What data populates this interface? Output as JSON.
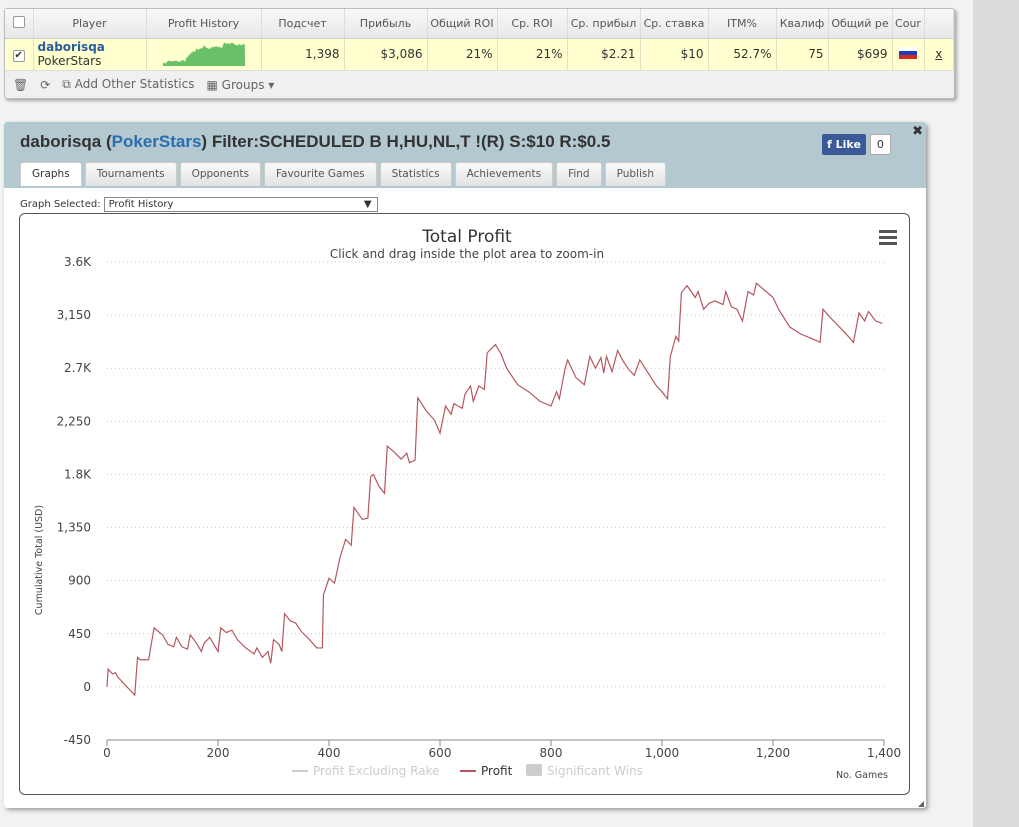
{
  "table": {
    "headers": [
      "Player",
      "Profit History",
      "Подсчет",
      "Прибыль",
      "Общий ROI",
      "Ср. ROI",
      "Ср. прибыл",
      "Ср. ставка",
      "ITM%",
      "Квалиф",
      "Общий ре",
      "Cour"
    ],
    "row": {
      "player": "daborisqa",
      "site": "PokerStars",
      "count": "1,398",
      "profit": "$3,086",
      "total_roi": "21%",
      "avg_roi": "21%",
      "avg_profit": "$2.21",
      "avg_stake": "$10",
      "itm": "52.7%",
      "qual": "75",
      "total_re": "$699",
      "country": "russia-flag",
      "remove": "x"
    },
    "tools": {
      "add_stats": "Add Other Statistics",
      "groups": "Groups"
    }
  },
  "panel": {
    "player": "daborisqa",
    "site": "PokerStars",
    "filter": "Filter:SCHEDULED B H,HU,NL,T !(R) S:$10 R:$0.5",
    "like": "Like",
    "like_count": "0",
    "tabs": [
      "Graphs",
      "Tournaments",
      "Opponents",
      "Favourite Games",
      "Statistics",
      "Achievements",
      "Find",
      "Publish"
    ],
    "graph_label": "Graph Selected:",
    "graph_value": "Profit History"
  },
  "colors": {
    "line": "#b5575e",
    "spark": "#6abf69"
  },
  "chart_data": {
    "type": "line",
    "title": "Total Profit",
    "subtitle": "Click and drag inside the plot area to zoom-in",
    "xlabel": "No. Games",
    "ylabel": "Cumulative Total (USD)",
    "xlim": [
      0,
      1400
    ],
    "ylim": [
      -450,
      3600
    ],
    "xticks": [
      "0",
      "200",
      "400",
      "600",
      "800",
      "1,000",
      "1,200",
      "1,400"
    ],
    "yticks": [
      "-450",
      "0",
      "450",
      "900",
      "1,350",
      "1.8K",
      "2,250",
      "2.7K",
      "3,150",
      "3.6K"
    ],
    "legend": [
      "Profit Excluding Rake",
      "Profit",
      "Significant Wins"
    ],
    "series": [
      {
        "name": "Profit",
        "points": [
          [
            0,
            0
          ],
          [
            2,
            150
          ],
          [
            10,
            110
          ],
          [
            15,
            120
          ],
          [
            20,
            80
          ],
          [
            30,
            30
          ],
          [
            50,
            -70
          ],
          [
            55,
            250
          ],
          [
            60,
            230
          ],
          [
            75,
            230
          ],
          [
            80,
            370
          ],
          [
            85,
            500
          ],
          [
            90,
            480
          ],
          [
            100,
            440
          ],
          [
            110,
            360
          ],
          [
            120,
            340
          ],
          [
            125,
            420
          ],
          [
            135,
            340
          ],
          [
            145,
            320
          ],
          [
            150,
            440
          ],
          [
            160,
            380
          ],
          [
            170,
            300
          ],
          [
            175,
            370
          ],
          [
            185,
            420
          ],
          [
            200,
            300
          ],
          [
            205,
            500
          ],
          [
            215,
            460
          ],
          [
            225,
            480
          ],
          [
            235,
            400
          ],
          [
            250,
            330
          ],
          [
            265,
            280
          ],
          [
            270,
            330
          ],
          [
            280,
            250
          ],
          [
            290,
            300
          ],
          [
            295,
            200
          ],
          [
            300,
            400
          ],
          [
            310,
            360
          ],
          [
            315,
            300
          ],
          [
            320,
            620
          ],
          [
            330,
            560
          ],
          [
            340,
            540
          ],
          [
            350,
            470
          ],
          [
            365,
            400
          ],
          [
            378,
            330
          ],
          [
            388,
            330
          ],
          [
            390,
            780
          ],
          [
            400,
            920
          ],
          [
            410,
            880
          ],
          [
            420,
            1100
          ],
          [
            430,
            1250
          ],
          [
            440,
            1200
          ],
          [
            445,
            1520
          ],
          [
            460,
            1420
          ],
          [
            470,
            1430
          ],
          [
            475,
            1780
          ],
          [
            480,
            1800
          ],
          [
            490,
            1700
          ],
          [
            500,
            1640
          ],
          [
            505,
            2040
          ],
          [
            515,
            2000
          ],
          [
            530,
            1930
          ],
          [
            540,
            1980
          ],
          [
            545,
            1900
          ],
          [
            555,
            1920
          ],
          [
            560,
            2450
          ],
          [
            575,
            2340
          ],
          [
            590,
            2260
          ],
          [
            600,
            2150
          ],
          [
            610,
            2380
          ],
          [
            620,
            2310
          ],
          [
            625,
            2400
          ],
          [
            640,
            2360
          ],
          [
            645,
            2480
          ],
          [
            655,
            2550
          ],
          [
            660,
            2420
          ],
          [
            670,
            2550
          ],
          [
            680,
            2520
          ],
          [
            685,
            2830
          ],
          [
            700,
            2900
          ],
          [
            710,
            2820
          ],
          [
            720,
            2700
          ],
          [
            740,
            2560
          ],
          [
            760,
            2500
          ],
          [
            780,
            2420
          ],
          [
            800,
            2380
          ],
          [
            810,
            2500
          ],
          [
            815,
            2440
          ],
          [
            825,
            2690
          ],
          [
            830,
            2770
          ],
          [
            845,
            2620
          ],
          [
            860,
            2560
          ],
          [
            870,
            2800
          ],
          [
            880,
            2700
          ],
          [
            890,
            2790
          ],
          [
            895,
            2660
          ],
          [
            900,
            2800
          ],
          [
            910,
            2670
          ],
          [
            920,
            2850
          ],
          [
            930,
            2760
          ],
          [
            940,
            2690
          ],
          [
            950,
            2640
          ],
          [
            960,
            2770
          ],
          [
            975,
            2660
          ],
          [
            990,
            2550
          ],
          [
            1000,
            2500
          ],
          [
            1010,
            2440
          ],
          [
            1015,
            2800
          ],
          [
            1025,
            2970
          ],
          [
            1030,
            2930
          ],
          [
            1035,
            3340
          ],
          [
            1045,
            3400
          ],
          [
            1060,
            3300
          ],
          [
            1065,
            3350
          ],
          [
            1075,
            3200
          ],
          [
            1085,
            3250
          ],
          [
            1095,
            3270
          ],
          [
            1110,
            3240
          ],
          [
            1115,
            3350
          ],
          [
            1125,
            3220
          ],
          [
            1135,
            3200
          ],
          [
            1145,
            3100
          ],
          [
            1155,
            3350
          ],
          [
            1165,
            3320
          ],
          [
            1170,
            3420
          ],
          [
            1180,
            3380
          ],
          [
            1200,
            3300
          ],
          [
            1210,
            3200
          ],
          [
            1230,
            3050
          ],
          [
            1250,
            2990
          ],
          [
            1270,
            2950
          ],
          [
            1285,
            2920
          ],
          [
            1290,
            3200
          ],
          [
            1305,
            3120
          ],
          [
            1330,
            3000
          ],
          [
            1345,
            2920
          ],
          [
            1355,
            3170
          ],
          [
            1365,
            3100
          ],
          [
            1372,
            3180
          ],
          [
            1385,
            3100
          ],
          [
            1397,
            3080
          ]
        ]
      }
    ]
  }
}
